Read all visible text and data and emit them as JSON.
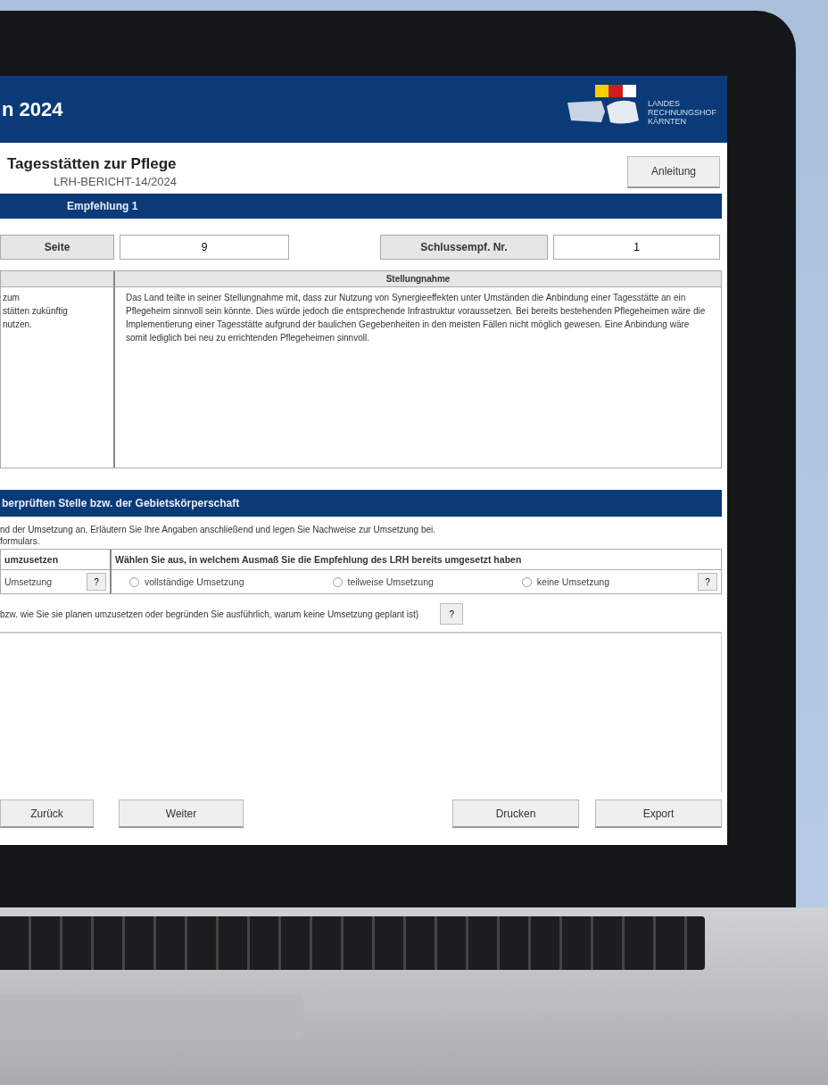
{
  "header": {
    "title": "n 2024",
    "logo_lines": [
      "LANDES",
      "RECHNUNGSHOF",
      "KÄRNTEN"
    ]
  },
  "report": {
    "title": "Tagesstätten zur Pflege",
    "code": "LRH-BERICHT-14/2024",
    "help_button": "Anleitung"
  },
  "recommendation_bar": "Empfehlung 1",
  "fields": [
    {
      "label": "Seite",
      "value": "9"
    },
    {
      "label": "Schlussempf. Nr.",
      "value": "1"
    }
  ],
  "statement_table": {
    "column_2": "Stellungnahme",
    "left_text": "zum\nstätten zukünftig\nnutzen.",
    "statement": "Das Land teilte in seiner Stellungnahme mit, dass zur Nutzung von Synergieeffekten unter Umständen die Anbindung einer Tagesstätte an ein Pflegeheim sinnvoll sein könnte. Dies würde jedoch die entsprechende Infrastruktur voraussetzen. Bei bereits bestehenden Pflegeheimen wäre die Implementierung einer Tagesstätte aufgrund der baulichen Gegebenheiten in den meisten Fällen nicht möglich gewesen. Eine Anbindung wäre somit lediglich bei neu zu errichtenden Pflegeheimen sinnvoll."
  },
  "section_bar": "berprüften Stelle bzw. der Gebietskörperschaft",
  "instruction": "nd der Umsetzung an. Erläutern Sie Ihre Angaben anschließend und legen Sie Nachweise zur Umsetzung bei.\nformulars.",
  "implementation_table": {
    "column_1": "umzusetzen",
    "column_2": "Wählen Sie aus, in welchem Ausmaß Sie die Empfehlung des LRH bereits umgesetzt haben",
    "left_value": "Umsetzung",
    "help_buttons": [
      "?",
      "?"
    ],
    "options": [
      {
        "label": "vollständige Umsetzung",
        "selected": false
      },
      {
        "label": "teilweise Umsetzung",
        "selected": false
      },
      {
        "label": "keine Umsetzung",
        "selected": false
      }
    ]
  },
  "description_prompt": "bzw. wie Sie sie planen umzusetzen oder begründen Sie ausführlich, warum keine Umsetzung geplant ist)",
  "prompt_help": "?",
  "buttons": [
    "Zurück",
    "Weiter",
    "Drucken",
    "Export"
  ]
}
